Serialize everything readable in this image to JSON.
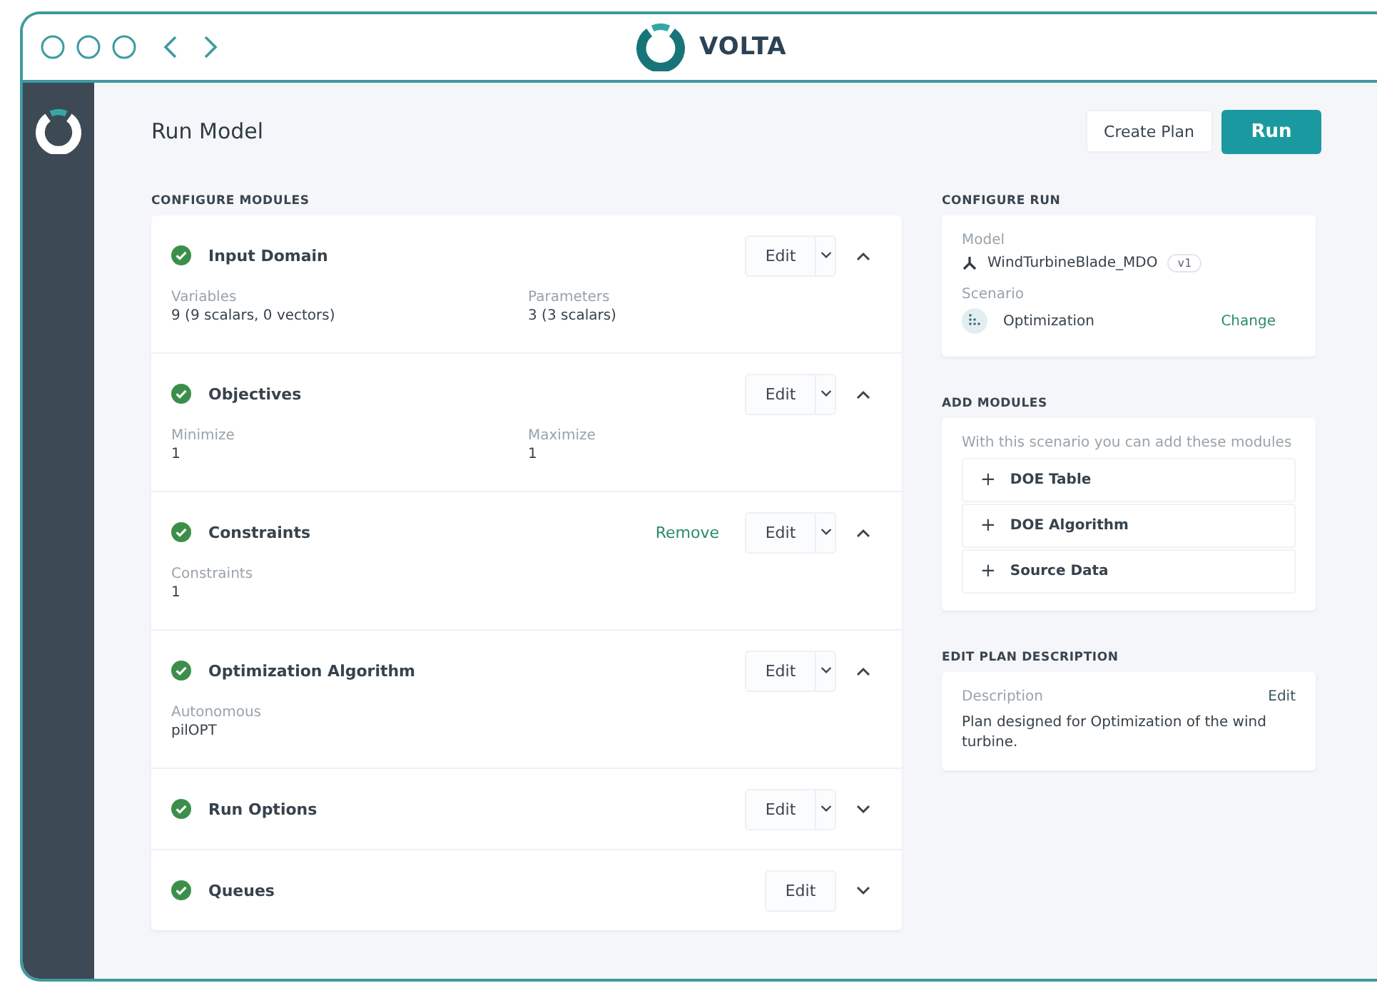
{
  "app": {
    "name": "VOLTA"
  },
  "page": {
    "title": "Run Model",
    "secondary_button": "Create Plan",
    "primary_button": "Run"
  },
  "configure_modules": {
    "heading": "CONFIGURE MODULES",
    "modules": [
      {
        "title": "Input Domain",
        "complete": true,
        "edit": "Edit",
        "has_menu": true,
        "expanded": true,
        "fields": [
          {
            "label": "Variables",
            "value": "9 (9 scalars, 0 vectors)"
          },
          {
            "label": "Parameters",
            "value": "3 (3 scalars)"
          }
        ]
      },
      {
        "title": "Objectives",
        "complete": true,
        "edit": "Edit",
        "has_menu": true,
        "expanded": true,
        "fields": [
          {
            "label": "Minimize",
            "value": "1"
          },
          {
            "label": "Maximize",
            "value": "1"
          }
        ]
      },
      {
        "title": "Constraints",
        "complete": true,
        "remove": "Remove",
        "edit": "Edit",
        "has_menu": true,
        "expanded": true,
        "fields": [
          {
            "label": "Constraints",
            "value": "1"
          }
        ]
      },
      {
        "title": "Optimization Algorithm",
        "complete": true,
        "edit": "Edit",
        "has_menu": true,
        "expanded": true,
        "fields": [
          {
            "label": "Autonomous",
            "value": "pilOPT"
          }
        ]
      },
      {
        "title": "Run Options",
        "complete": true,
        "edit": "Edit",
        "has_menu": true,
        "expanded": false
      },
      {
        "title": "Queues",
        "complete": true,
        "edit": "Edit",
        "has_menu": false,
        "expanded": false
      }
    ]
  },
  "configure_run": {
    "heading": "CONFIGURE RUN",
    "model_label": "Model",
    "model": "WindTurbineBlade_MDO",
    "version": "v1",
    "scenario_label": "Scenario",
    "scenario": "Optimization",
    "change": "Change"
  },
  "add_modules": {
    "heading": "ADD MODULES",
    "hint": "With this scenario you can add these modules",
    "items": [
      {
        "icon": "+",
        "label": "DOE Table"
      },
      {
        "icon": "+",
        "label": "DOE Algorithm"
      },
      {
        "icon": "+",
        "label": "Source Data"
      }
    ]
  },
  "plan_description": {
    "heading": "EDIT PLAN DESCRIPTION",
    "label": "Description",
    "edit": "Edit",
    "text": "Plan designed for Optimization of the wind turbine."
  }
}
